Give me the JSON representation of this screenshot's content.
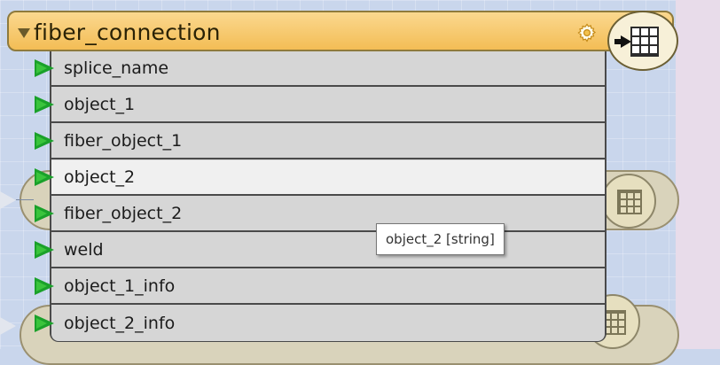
{
  "transformer": {
    "title": "fiber_connection",
    "icons": {
      "collapse": "collapse-triangle-icon",
      "settings": "gear-icon",
      "type": "table-writer-icon"
    }
  },
  "attributes": [
    {
      "label": "splice_name"
    },
    {
      "label": "object_1"
    },
    {
      "label": "fiber_object_1"
    },
    {
      "label": "object_2",
      "selected": true
    },
    {
      "label": "fiber_object_2"
    },
    {
      "label": "weld"
    },
    {
      "label": "object_1_info"
    },
    {
      "label": "object_2_info"
    }
  ],
  "tooltip": {
    "text": "object_2 [string]"
  },
  "colors": {
    "header": "#f3bd55",
    "port": "#1aa12a",
    "canvas": "#c9d6ec"
  }
}
